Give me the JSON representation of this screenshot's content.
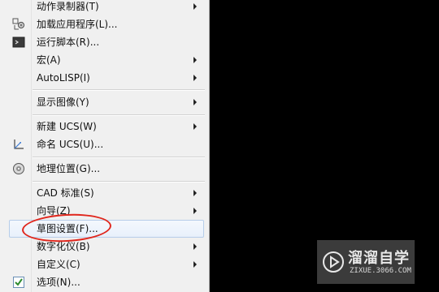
{
  "menu": {
    "items": {
      "action_recorder": "动作录制器(T)",
      "load_application": "加载应用程序(L)...",
      "run_script": "运行脚本(R)...",
      "macro": "宏(A)",
      "autolisp": "AutoLISP(I)",
      "display_image": "显示图像(Y)",
      "new_ucs": "新建 UCS(W)",
      "named_ucs": "命名 UCS(U)...",
      "geographic_location": "地理位置(G)...",
      "cad_standards": "CAD 标准(S)",
      "wizards": "向导(Z)",
      "drafting_settings": "草图设置(F)...",
      "digitizer": "数字化仪(B)",
      "customize": "自定义(C)",
      "options": "选项(N)..."
    }
  },
  "watermark": {
    "brand": "溜溜自学",
    "domain": "ZIXUE.3066.COM"
  },
  "colors": {
    "annotation": "#e0271d",
    "background": "#000000",
    "menu_bg": "#f0f0f0",
    "highlight_border": "#b6cde9"
  }
}
